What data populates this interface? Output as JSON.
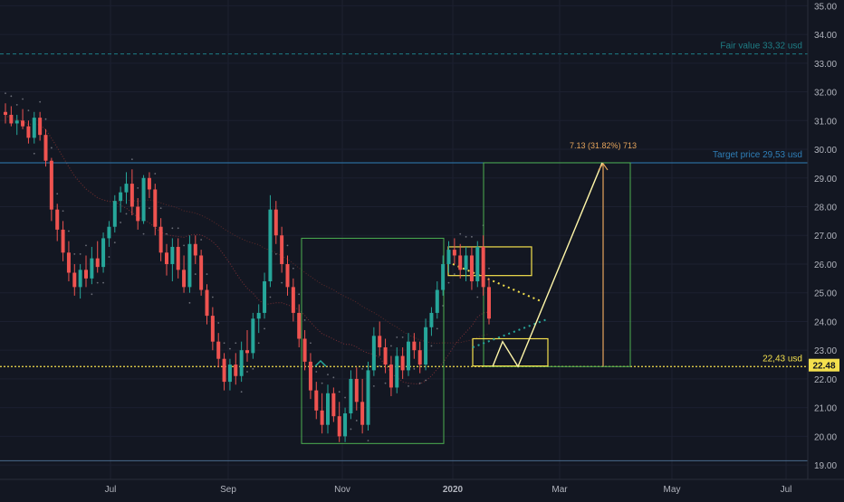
{
  "colors": {
    "background": "#131722",
    "grid": "#1c2030",
    "up_candle": "#26a69a",
    "down_candle": "#ef5350",
    "fair_value": "#1e7e86",
    "target_line": "#2f7fb8",
    "support": "#f4e04d",
    "green_box": "#4caf50",
    "yellow_box": "#f4e04d",
    "projection": "#fff6a8",
    "measure": "#e6a55c",
    "axis_text": "#b2b5be",
    "ma_line": "#8b3a3a",
    "psar": "#b2b5be"
  },
  "chart_data": {
    "type": "candlestick",
    "y_axis": {
      "ticks": [
        "35.00",
        "34.00",
        "33.00",
        "32.00",
        "31.00",
        "30.00",
        "29.00",
        "28.00",
        "27.00",
        "26.00",
        "25.00",
        "24.00",
        "23.00",
        "22.00",
        "21.00",
        "20.00",
        "19.00"
      ],
      "ylim": [
        18.5,
        35.2
      ]
    },
    "x_axis": {
      "ticks": [
        "Jul",
        "Sep",
        "Nov",
        "2020",
        "Mar",
        "May",
        "Jul"
      ]
    },
    "ohlc": [
      [
        31.3,
        31.6,
        30.9,
        31.2
      ],
      [
        31.2,
        31.5,
        30.8,
        30.9
      ],
      [
        30.9,
        31.2,
        30.5,
        31.0
      ],
      [
        31.0,
        31.4,
        30.7,
        30.8
      ],
      [
        30.8,
        31.0,
        30.2,
        30.4
      ],
      [
        30.4,
        31.3,
        30.2,
        31.1
      ],
      [
        31.1,
        31.3,
        30.3,
        30.5
      ],
      [
        30.5,
        30.7,
        29.4,
        29.6
      ],
      [
        29.6,
        29.7,
        27.5,
        27.9
      ],
      [
        27.9,
        28.1,
        26.8,
        27.2
      ],
      [
        27.2,
        27.5,
        26.1,
        26.4
      ],
      [
        26.4,
        26.8,
        25.4,
        25.7
      ],
      [
        25.7,
        26.0,
        24.9,
        25.2
      ],
      [
        25.2,
        26.0,
        24.8,
        25.8
      ],
      [
        25.8,
        26.3,
        25.2,
        25.5
      ],
      [
        25.5,
        26.6,
        25.3,
        26.2
      ],
      [
        26.2,
        26.8,
        25.7,
        25.9
      ],
      [
        25.9,
        27.1,
        25.7,
        26.9
      ],
      [
        26.9,
        27.5,
        26.6,
        27.3
      ],
      [
        27.3,
        28.4,
        27.1,
        28.2
      ],
      [
        28.2,
        28.7,
        27.8,
        28.5
      ],
      [
        28.5,
        29.2,
        28.1,
        28.8
      ],
      [
        28.8,
        29.3,
        27.7,
        28.0
      ],
      [
        28.0,
        28.3,
        27.2,
        27.5
      ],
      [
        27.5,
        29.1,
        27.4,
        29.0
      ],
      [
        29.0,
        29.2,
        28.3,
        28.6
      ],
      [
        28.6,
        28.8,
        27.0,
        27.3
      ],
      [
        27.3,
        27.6,
        26.1,
        26.4
      ],
      [
        26.4,
        26.7,
        25.6,
        26.0
      ],
      [
        26.0,
        26.9,
        25.4,
        26.6
      ],
      [
        26.6,
        26.9,
        25.5,
        25.8
      ],
      [
        25.8,
        26.3,
        25.0,
        25.2
      ],
      [
        25.2,
        27.0,
        25.0,
        26.7
      ],
      [
        26.7,
        27.0,
        26.0,
        26.3
      ],
      [
        26.3,
        26.5,
        24.9,
        25.1
      ],
      [
        25.1,
        25.3,
        23.9,
        24.2
      ],
      [
        24.2,
        24.5,
        23.0,
        23.3
      ],
      [
        23.3,
        23.6,
        22.4,
        22.7
      ],
      [
        22.7,
        22.9,
        21.6,
        21.9
      ],
      [
        21.9,
        22.7,
        21.6,
        22.5
      ],
      [
        22.5,
        22.9,
        21.8,
        22.1
      ],
      [
        22.1,
        23.3,
        21.9,
        23.0
      ],
      [
        23.0,
        23.7,
        22.6,
        22.9
      ],
      [
        22.9,
        24.3,
        22.7,
        24.1
      ],
      [
        24.1,
        24.6,
        23.6,
        24.3
      ],
      [
        24.3,
        25.7,
        24.1,
        25.4
      ],
      [
        25.4,
        28.4,
        25.2,
        27.9
      ],
      [
        27.9,
        28.2,
        26.7,
        27.0
      ],
      [
        27.0,
        27.3,
        25.7,
        26.0
      ],
      [
        26.0,
        26.3,
        24.9,
        25.2
      ],
      [
        25.2,
        25.5,
        24.0,
        24.3
      ],
      [
        24.3,
        24.6,
        23.1,
        23.4
      ],
      [
        23.4,
        23.7,
        22.3,
        22.6
      ],
      [
        22.6,
        22.9,
        21.3,
        21.6
      ],
      [
        21.6,
        21.9,
        20.6,
        20.9
      ],
      [
        20.9,
        21.5,
        20.1,
        20.4
      ],
      [
        20.4,
        21.8,
        20.1,
        21.5
      ],
      [
        21.5,
        21.7,
        20.5,
        20.7
      ],
      [
        20.7,
        21.2,
        19.8,
        20.0
      ],
      [
        20.0,
        21.0,
        19.8,
        20.8
      ],
      [
        20.8,
        22.3,
        20.6,
        22.0
      ],
      [
        22.0,
        22.4,
        20.9,
        21.2
      ],
      [
        21.2,
        22.0,
        20.1,
        20.4
      ],
      [
        20.4,
        22.6,
        20.2,
        22.3
      ],
      [
        22.3,
        23.8,
        22.1,
        23.5
      ],
      [
        23.5,
        24.0,
        22.8,
        23.1
      ],
      [
        23.1,
        23.4,
        22.2,
        22.5
      ],
      [
        22.5,
        22.8,
        21.4,
        21.7
      ],
      [
        21.7,
        23.1,
        21.5,
        22.8
      ],
      [
        22.8,
        23.1,
        22.0,
        22.3
      ],
      [
        22.3,
        23.6,
        22.1,
        23.3
      ],
      [
        23.3,
        23.6,
        22.7,
        23.0
      ],
      [
        23.0,
        23.3,
        22.2,
        22.5
      ],
      [
        22.5,
        24.1,
        22.3,
        23.8
      ],
      [
        23.8,
        24.5,
        23.5,
        24.3
      ],
      [
        24.3,
        25.4,
        24.1,
        25.1
      ],
      [
        25.1,
        26.3,
        24.9,
        26.0
      ],
      [
        26.0,
        26.8,
        25.7,
        26.5
      ],
      [
        26.5,
        26.9,
        26.0,
        26.3
      ],
      [
        26.3,
        26.7,
        25.5,
        25.8
      ],
      [
        25.8,
        26.6,
        25.4,
        26.3
      ],
      [
        26.3,
        26.6,
        25.1,
        25.4
      ],
      [
        25.4,
        26.8,
        25.2,
        26.6
      ],
      [
        26.6,
        27.0,
        24.9,
        25.2
      ],
      [
        25.2,
        25.5,
        23.9,
        24.1
      ]
    ],
    "levels": [
      {
        "label": "Fair value 33,32 usd",
        "price": 33.32
      },
      {
        "label": "Target price 29,53 usd",
        "price": 29.53
      },
      {
        "label": "22,43 usd",
        "price": 22.43
      },
      {
        "label": "",
        "price": 19.15
      }
    ],
    "current_price": "22.48",
    "measure_label": "7.13 (31.82%) 713"
  }
}
